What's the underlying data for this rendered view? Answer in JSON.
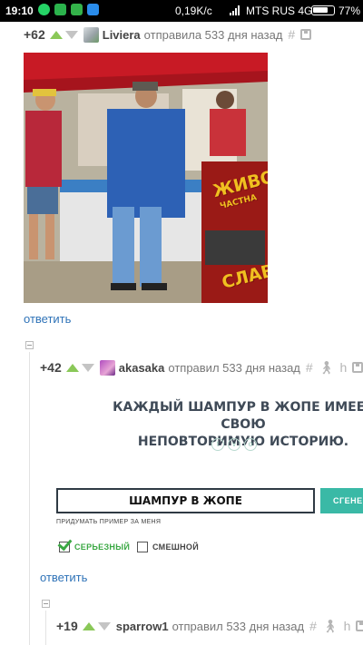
{
  "status_bar": {
    "time": "19:10",
    "network_speed": "0,19K/c",
    "carrier": "MTS RUS 4G",
    "battery": "77%",
    "battery_level": 0.77
  },
  "comments": [
    {
      "rating": "+62",
      "author": "Liviera",
      "meta": "отправила 533 дня назад",
      "reply": "ответить"
    },
    {
      "rating": "+42",
      "author": "akasaka",
      "meta": "отправил 533 дня назад",
      "reply": "ответить"
    },
    {
      "rating": "+19",
      "author": "sparrow1",
      "meta": "отправил 533 дня назад"
    }
  ],
  "photo": {
    "sign_line1": "ЖИВО",
    "sign_line2": "ЧАСТНА",
    "sign_line3": "СЛАВ"
  },
  "meme": {
    "title": "КАЖДЫЙ ШАМПУР В ЖОПЕ ИМЕЕТ СВОЮ\nНЕПОВТОРИМУЮ ИСТОРИЮ.",
    "input_value": "ШАМПУР В ЖОПЕ",
    "button_label": "СГЕНЕ",
    "hint": "ПРИДУМАТЬ ПРИМЕР ЗА МЕНЯ",
    "option_serious": "СЕРЬЕЗНЫЙ",
    "option_funny": "СМЕШНОЙ"
  },
  "icons": {
    "link": "hash-icon",
    "save": "save-icon",
    "person": "person-icon",
    "chair": "chair-icon"
  },
  "colors": {
    "vote_up": "#8ac858",
    "link": "#2f73b8",
    "meme_button": "#3ab9a6"
  }
}
